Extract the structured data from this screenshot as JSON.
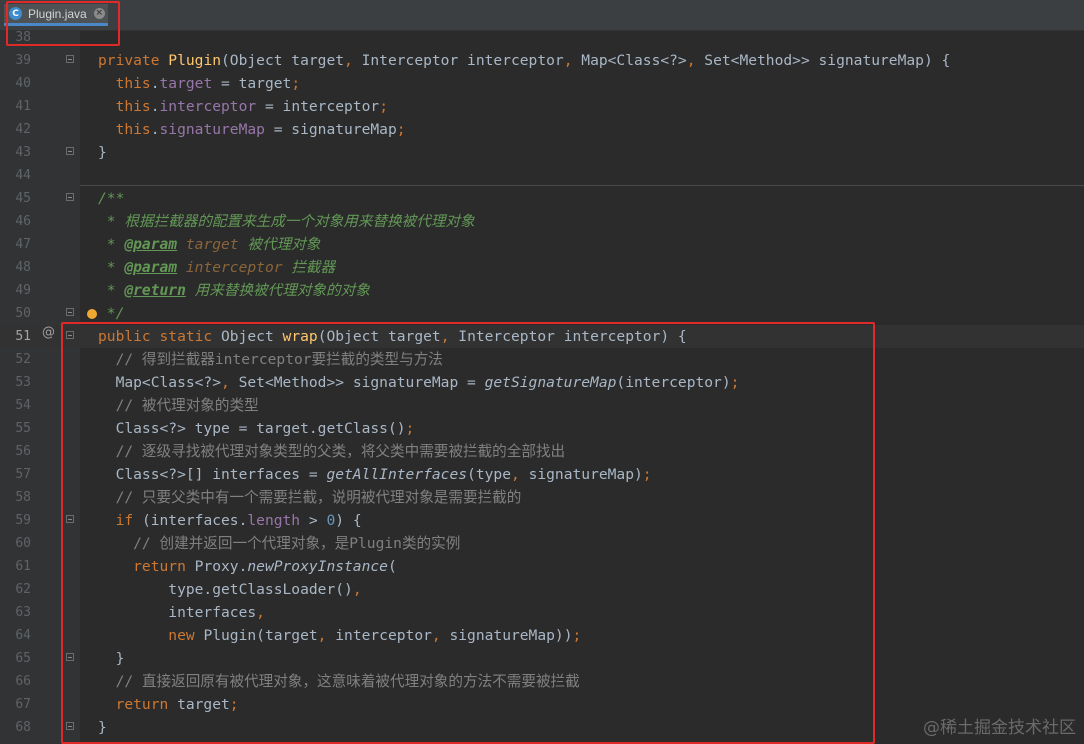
{
  "tab": {
    "icon_text": "C",
    "title": "Plugin.java",
    "close": "×"
  },
  "gutter": {
    "override_marker": "@"
  },
  "lines": [
    {
      "n": "38",
      "tokens": []
    },
    {
      "n": "39",
      "tokens": [
        {
          "t": "private ",
          "c": "kw"
        },
        {
          "t": "Plugin",
          "c": "mth"
        },
        {
          "t": "(Object target",
          "c": ""
        },
        {
          "t": ", ",
          "c": "kw"
        },
        {
          "t": "Interceptor interceptor",
          "c": ""
        },
        {
          "t": ", ",
          "c": "kw"
        },
        {
          "t": "Map<Class<?>",
          "c": ""
        },
        {
          "t": ", ",
          "c": "kw"
        },
        {
          "t": "Set<Method>> signatureMap) {",
          "c": ""
        }
      ]
    },
    {
      "n": "40",
      "tokens": [
        {
          "t": "  this",
          "c": "kw"
        },
        {
          "t": ".",
          "c": ""
        },
        {
          "t": "target",
          "c": "fld"
        },
        {
          "t": " = target",
          "c": ""
        },
        {
          "t": ";",
          "c": "kw"
        }
      ]
    },
    {
      "n": "41",
      "tokens": [
        {
          "t": "  this",
          "c": "kw"
        },
        {
          "t": ".",
          "c": ""
        },
        {
          "t": "interceptor",
          "c": "fld"
        },
        {
          "t": " = interceptor",
          "c": ""
        },
        {
          "t": ";",
          "c": "kw"
        }
      ]
    },
    {
      "n": "42",
      "tokens": [
        {
          "t": "  this",
          "c": "kw"
        },
        {
          "t": ".",
          "c": ""
        },
        {
          "t": "signatureMap",
          "c": "fld"
        },
        {
          "t": " = signatureMap",
          "c": ""
        },
        {
          "t": ";",
          "c": "kw"
        }
      ]
    },
    {
      "n": "43",
      "tokens": [
        {
          "t": "}",
          "c": ""
        }
      ]
    },
    {
      "n": "44",
      "tokens": []
    },
    {
      "n": "45",
      "tokens": [
        {
          "t": "/**",
          "c": "doc"
        }
      ]
    },
    {
      "n": "46",
      "tokens": [
        {
          "t": " * 根据拦截器的配置来生成一个对象用来替换被代理对象",
          "c": "doc"
        }
      ]
    },
    {
      "n": "47",
      "tokens": [
        {
          "t": " * ",
          "c": "doc"
        },
        {
          "t": "@param",
          "c": "doctag"
        },
        {
          "t": " ",
          "c": "doc"
        },
        {
          "t": "target",
          "c": "docparam"
        },
        {
          "t": " 被代理对象",
          "c": "doc"
        }
      ]
    },
    {
      "n": "48",
      "tokens": [
        {
          "t": " * ",
          "c": "doc"
        },
        {
          "t": "@param",
          "c": "doctag"
        },
        {
          "t": " ",
          "c": "doc"
        },
        {
          "t": "interceptor",
          "c": "docparam"
        },
        {
          "t": " 拦截器",
          "c": "doc"
        }
      ]
    },
    {
      "n": "49",
      "tokens": [
        {
          "t": " * ",
          "c": "doc"
        },
        {
          "t": "@return",
          "c": "doctag"
        },
        {
          "t": " 用来替换被代理对象的对象",
          "c": "doc"
        }
      ]
    },
    {
      "n": "50",
      "tokens": [
        {
          "t": " */",
          "c": "doc"
        }
      ]
    },
    {
      "n": "51",
      "tokens": [
        {
          "t": "public static ",
          "c": "kw"
        },
        {
          "t": "Object ",
          "c": ""
        },
        {
          "t": "wrap",
          "c": "mth"
        },
        {
          "t": "(Object target",
          "c": ""
        },
        {
          "t": ", ",
          "c": "kw"
        },
        {
          "t": "Interceptor interceptor) {",
          "c": ""
        }
      ]
    },
    {
      "n": "52",
      "tokens": [
        {
          "t": "  // 得到拦截器interceptor要拦截的类型与方法",
          "c": "cm"
        }
      ]
    },
    {
      "n": "53",
      "tokens": [
        {
          "t": "  Map<Class<?>",
          "c": ""
        },
        {
          "t": ", ",
          "c": "kw"
        },
        {
          "t": "Set<Method>> signatureMap = ",
          "c": ""
        },
        {
          "t": "getSignatureMap",
          "c": "it"
        },
        {
          "t": "(interceptor)",
          "c": ""
        },
        {
          "t": ";",
          "c": "kw"
        }
      ]
    },
    {
      "n": "54",
      "tokens": [
        {
          "t": "  // 被代理对象的类型",
          "c": "cm"
        }
      ]
    },
    {
      "n": "55",
      "tokens": [
        {
          "t": "  Class<?> type = target.getClass()",
          "c": ""
        },
        {
          "t": ";",
          "c": "kw"
        }
      ]
    },
    {
      "n": "56",
      "tokens": [
        {
          "t": "  // 逐级寻找被代理对象类型的父类，将父类中需要被拦截的全部找出",
          "c": "cm"
        }
      ]
    },
    {
      "n": "57",
      "tokens": [
        {
          "t": "  Class<?>[] interfaces = ",
          "c": ""
        },
        {
          "t": "getAllInterfaces",
          "c": "it"
        },
        {
          "t": "(type",
          "c": ""
        },
        {
          "t": ", ",
          "c": "kw"
        },
        {
          "t": "signatureMap)",
          "c": ""
        },
        {
          "t": ";",
          "c": "kw"
        }
      ]
    },
    {
      "n": "58",
      "tokens": [
        {
          "t": "  // 只要父类中有一个需要拦截，说明被代理对象是需要拦截的",
          "c": "cm"
        }
      ]
    },
    {
      "n": "59",
      "tokens": [
        {
          "t": "  if ",
          "c": "kw"
        },
        {
          "t": "(interfaces.",
          "c": ""
        },
        {
          "t": "length",
          "c": "fld"
        },
        {
          "t": " > ",
          "c": ""
        },
        {
          "t": "0",
          "c": "num"
        },
        {
          "t": ") {",
          "c": ""
        }
      ]
    },
    {
      "n": "60",
      "tokens": [
        {
          "t": "    // 创建并返回一个代理对象，是Plugin类的实例",
          "c": "cm"
        }
      ]
    },
    {
      "n": "61",
      "tokens": [
        {
          "t": "    return ",
          "c": "kw"
        },
        {
          "t": "Proxy.",
          "c": ""
        },
        {
          "t": "newProxyInstance",
          "c": "it"
        },
        {
          "t": "(",
          "c": ""
        }
      ]
    },
    {
      "n": "62",
      "tokens": [
        {
          "t": "        type.getClassLoader()",
          "c": ""
        },
        {
          "t": ",",
          "c": "kw"
        }
      ]
    },
    {
      "n": "63",
      "tokens": [
        {
          "t": "        interfaces",
          "c": ""
        },
        {
          "t": ",",
          "c": "kw"
        }
      ]
    },
    {
      "n": "64",
      "tokens": [
        {
          "t": "        new ",
          "c": "kw"
        },
        {
          "t": "Plugin(target",
          "c": ""
        },
        {
          "t": ", ",
          "c": "kw"
        },
        {
          "t": "interceptor",
          "c": ""
        },
        {
          "t": ", ",
          "c": "kw"
        },
        {
          "t": "signatureMap))",
          "c": ""
        },
        {
          "t": ";",
          "c": "kw"
        }
      ]
    },
    {
      "n": "65",
      "tokens": [
        {
          "t": "  }",
          "c": ""
        }
      ]
    },
    {
      "n": "66",
      "tokens": [
        {
          "t": "  // 直接返回原有被代理对象，这意味着被代理对象的方法不需要被拦截",
          "c": "cm"
        }
      ]
    },
    {
      "n": "67",
      "tokens": [
        {
          "t": "  return ",
          "c": "kw"
        },
        {
          "t": "target",
          "c": ""
        },
        {
          "t": ";",
          "c": "kw"
        }
      ]
    },
    {
      "n": "68",
      "tokens": [
        {
          "t": "}",
          "c": ""
        }
      ]
    }
  ],
  "watermark": "@稀土掘金技术社区",
  "colors": {
    "background": "#2b2b2b",
    "keyword": "#cc7832",
    "field": "#9876aa",
    "method_decl": "#ffc66d",
    "comment": "#808080",
    "javadoc": "#629755",
    "highlight_box": "#e02a2a"
  }
}
